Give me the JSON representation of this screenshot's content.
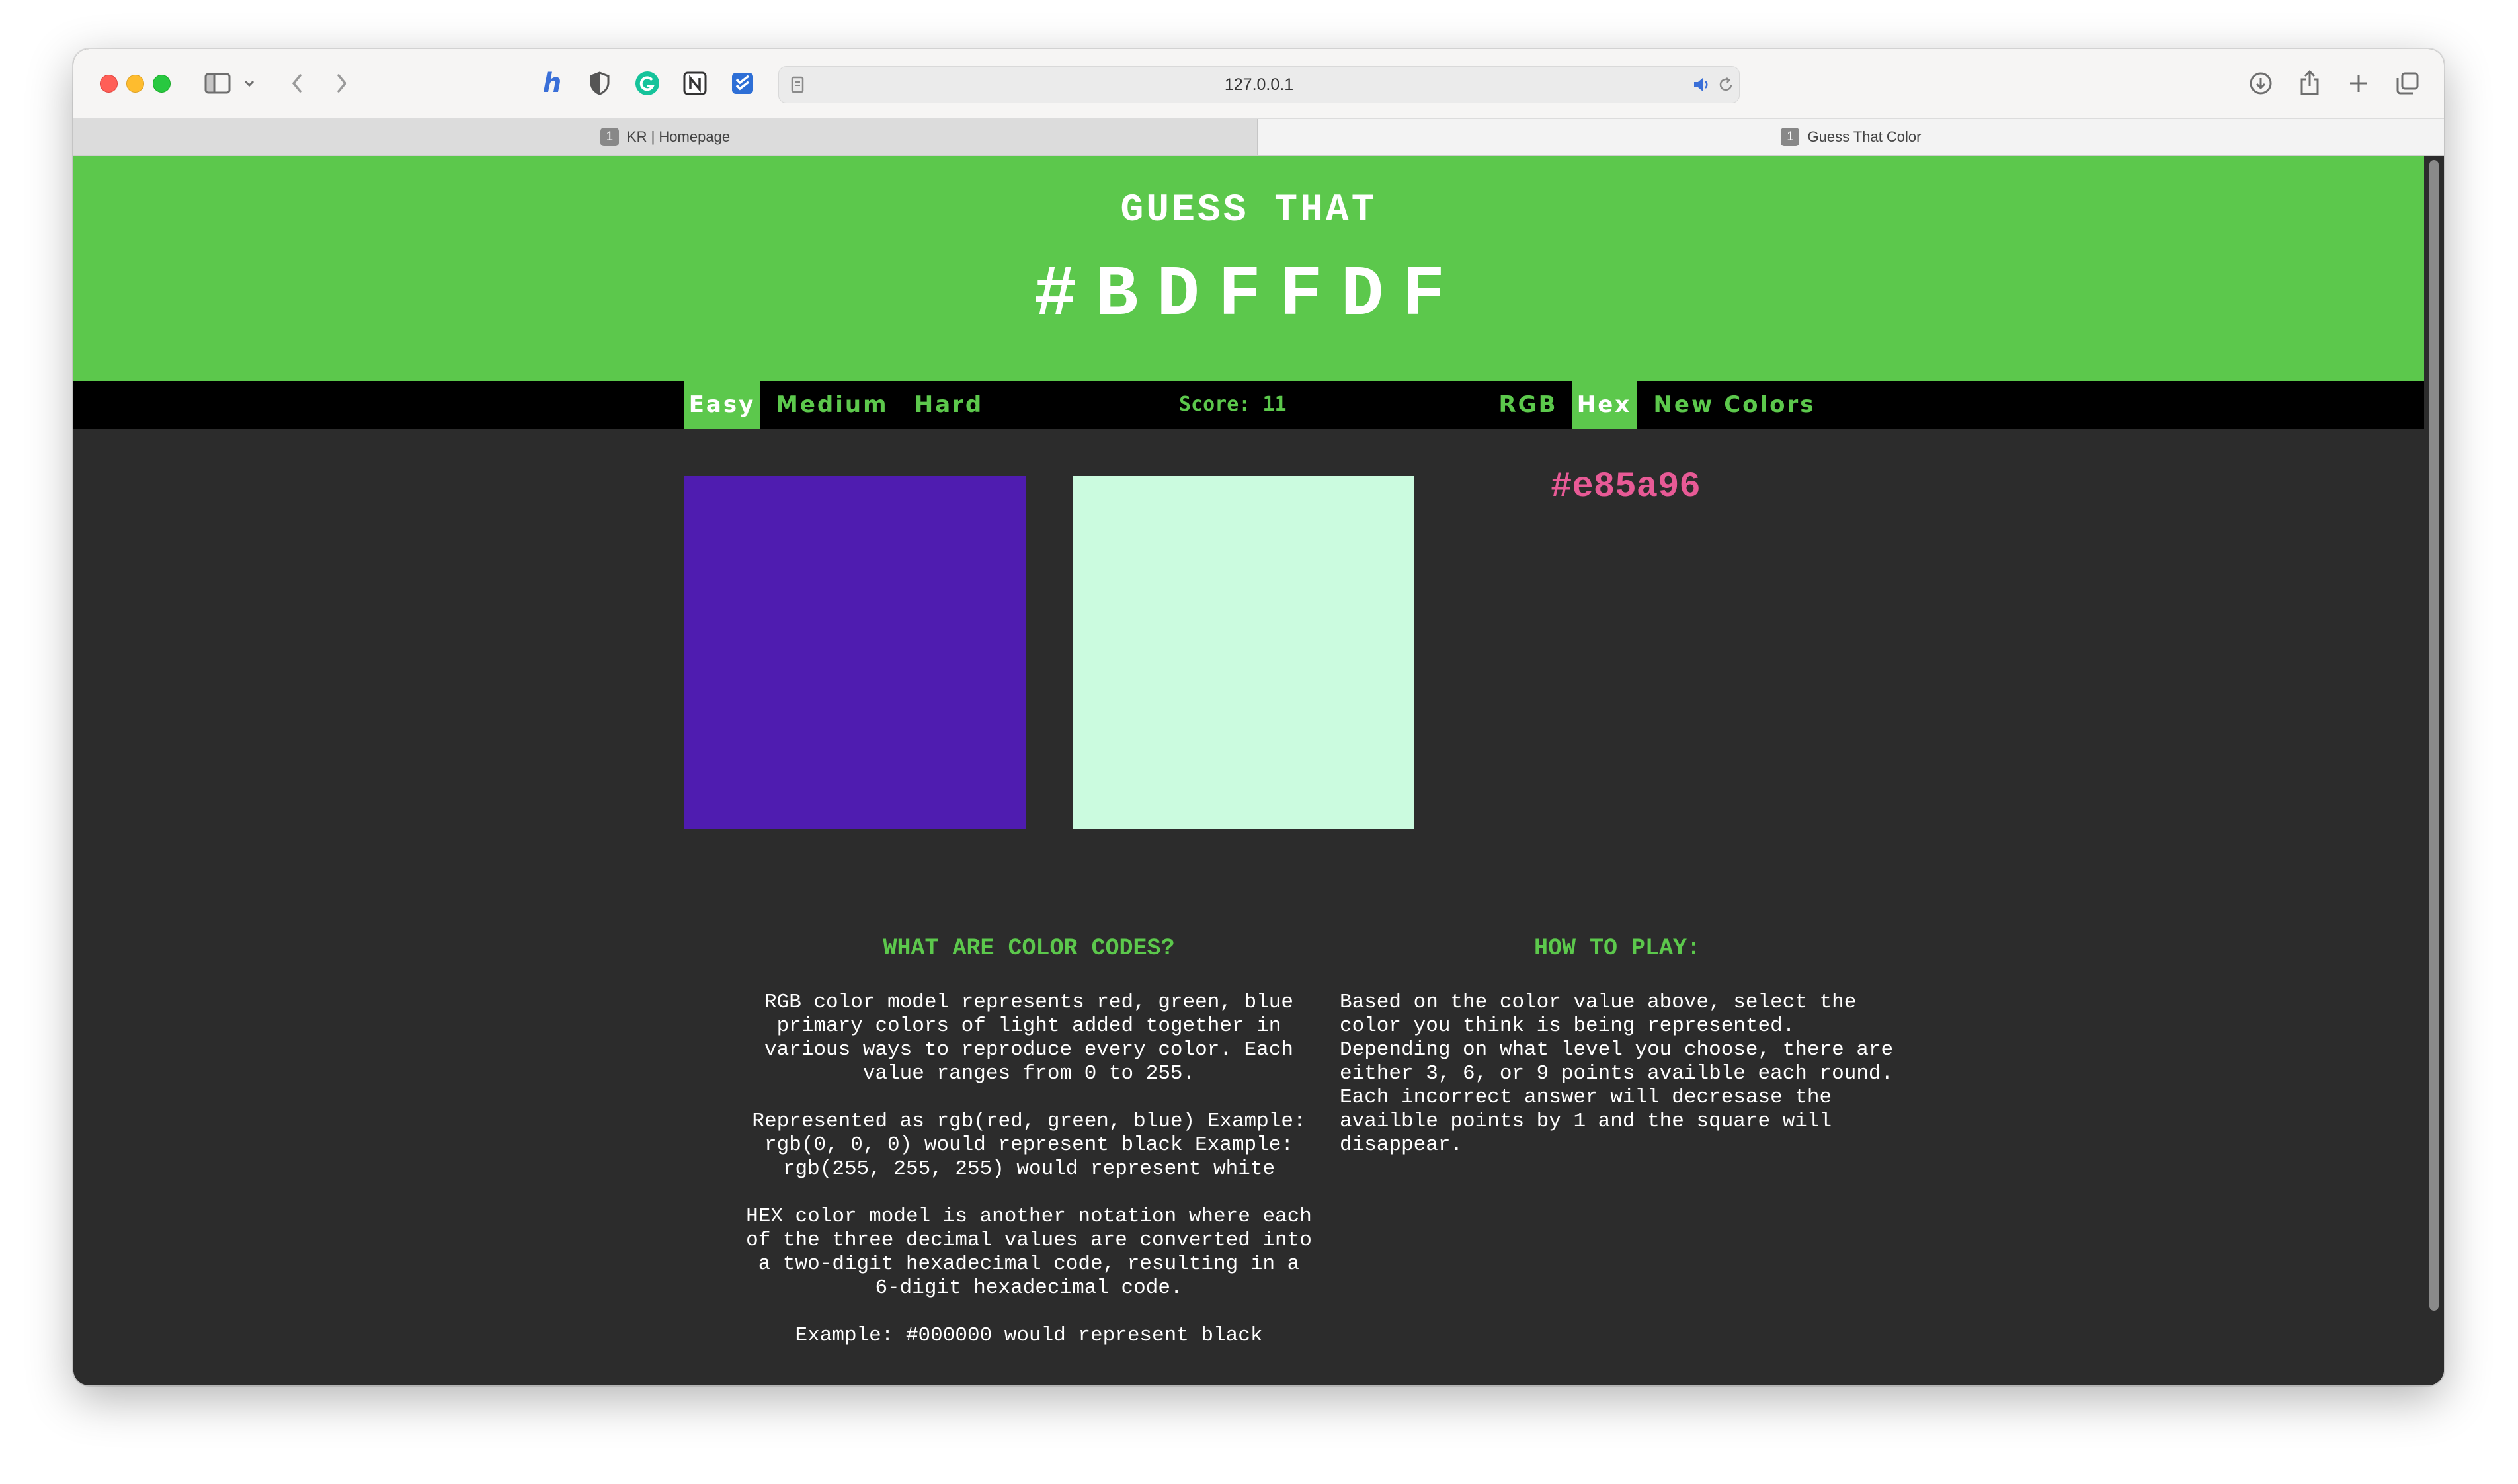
{
  "browser": {
    "url": "127.0.0.1",
    "tabs": [
      {
        "badge": "1",
        "label": "KR | Homepage"
      },
      {
        "badge": "1",
        "label": "Guess That Color"
      }
    ]
  },
  "header": {
    "subtitle": "GUESS THAT",
    "target_code": "#BDFFDF",
    "background_color": "#5cc84c"
  },
  "nav": {
    "difficulty": [
      {
        "label": "Easy",
        "active": true
      },
      {
        "label": "Medium",
        "active": false
      },
      {
        "label": "Hard",
        "active": false
      }
    ],
    "score_label": "Score: 11",
    "modes": [
      {
        "label": "RGB",
        "active": false
      },
      {
        "label": "Hex",
        "active": true
      }
    ],
    "new_colors_label": "New Colors"
  },
  "game": {
    "squares": [
      {
        "color": "#4f1cb0"
      },
      {
        "color": "#cbfbdf"
      }
    ],
    "feedback_code": "#e85a96",
    "feedback_color": "#e85a96"
  },
  "info": {
    "what_title": "WHAT ARE COLOR CODES?",
    "what_paragraphs": [
      "RGB color model represents red, green, blue primary colors of light added together in various ways to reproduce every color. Each value ranges from 0 to 255.",
      "Represented as rgb(red, green, blue) Example: rgb(0, 0, 0) would represent black Example: rgb(255, 255, 255) would represent white",
      "HEX color model is another notation where each of the three decimal values are converted into a two-digit hexadecimal code, resulting in a 6-digit hexadecimal code.",
      "Example: #000000 would represent black"
    ],
    "how_title": "HOW TO PLAY:",
    "how_paragraph": "Based on the color value above, select the color you think is being represented. Depending on what level you choose, there are either 3, 6, or 9 points availble each round. Each incorrect answer will decresase the availble points by 1 and the square will disappear."
  }
}
